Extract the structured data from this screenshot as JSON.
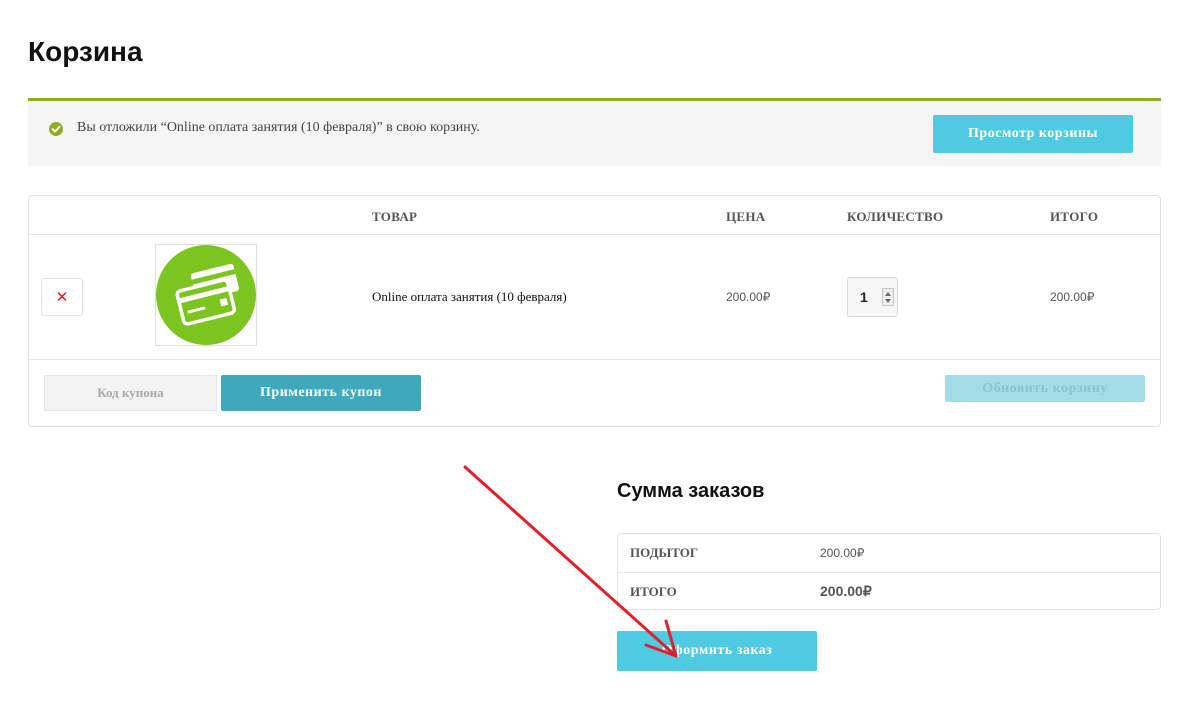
{
  "page": {
    "title": "Корзина"
  },
  "notice": {
    "message": "Вы отложили “Online оплата занятия (10 февраля)” в свою корзину.",
    "button_label": "Просмотр корзины",
    "icon": "check-circle-icon",
    "icon_color": "#8fae1b"
  },
  "cart": {
    "columns": {
      "product": "ТОВАР",
      "price": "ЦЕНА",
      "quantity": "КОЛИЧЕСТВО",
      "total": "ИТОГО"
    },
    "items": [
      {
        "remove_icon": "close-icon",
        "thumbnail_icon": "credit-cards-icon",
        "thumbnail_color": "#7cc520",
        "name": "Online оплата занятия (10 февраля)",
        "price": "200.00₽",
        "quantity": "1",
        "total": "200.00₽"
      }
    ],
    "coupon_placeholder": "Код купона",
    "apply_coupon_label": "Применить купон",
    "update_cart_label": "Обновить корзину"
  },
  "totals": {
    "title": "Сумма заказов",
    "subtotal_label": "ПОДЫТОГ",
    "subtotal_value": "200.00₽",
    "total_label": "ИТОГО",
    "total_value": "200.00₽",
    "checkout_label": "Оформить заказ"
  },
  "colors": {
    "accent": "#4ecbe0",
    "apply_button": "#3fa9bb",
    "notice_border": "#8fae1b",
    "remove_icon": "#e21b1b",
    "annotation_arrow": "#e0202c"
  }
}
